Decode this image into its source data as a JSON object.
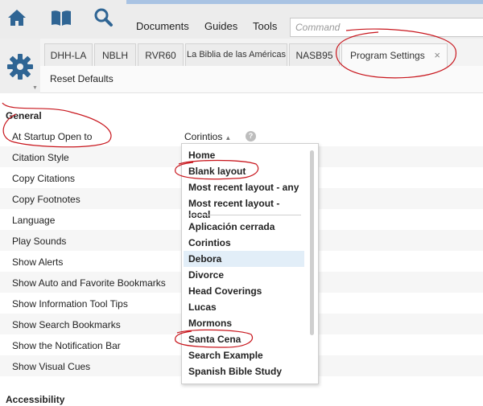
{
  "toolbar": {
    "nav": [
      "Documents",
      "Guides",
      "Tools"
    ],
    "command_placeholder": "Command",
    "icons": [
      "home-icon",
      "library-icon",
      "search-icon"
    ]
  },
  "tabs": [
    {
      "label": "DHH-LA"
    },
    {
      "label": "NBLH"
    },
    {
      "label": "RVR60"
    },
    {
      "label": "La Biblia de las Américas"
    },
    {
      "label": "NASB95"
    },
    {
      "label": "Program Settings",
      "active": true,
      "close": "×"
    }
  ],
  "subbar": {
    "reset": "Reset Defaults"
  },
  "settings": {
    "general_heading": "General",
    "items": [
      "At Startup Open to",
      "Citation Style",
      "Copy Citations",
      "Copy Footnotes",
      "Language",
      "Play Sounds",
      "Show Alerts",
      "Show Auto and Favorite Bookmarks",
      "Show Information Tool Tips",
      "Show Search Bookmarks",
      "Show the Notification Bar",
      "Show Visual Cues"
    ],
    "startup_value": "Corintios",
    "help": "?",
    "accessibility_heading": "Accessibility"
  },
  "dropdown": {
    "group1": [
      "Home",
      "Blank layout",
      "Most recent layout - any",
      "Most recent layout - local"
    ],
    "group2": [
      "Aplicación cerrada",
      "Corintios",
      "Debora",
      "Divorce",
      "Head Coverings",
      "Lucas",
      "Mormons",
      "Santa Cena",
      "Search Example",
      "Spanish Bible Study"
    ],
    "highlighted": "Debora"
  },
  "colors": {
    "accent": "#a9c3e3",
    "icon": "#2f6594",
    "highlight": "#e2eef8",
    "annotation": "#c8161d"
  }
}
